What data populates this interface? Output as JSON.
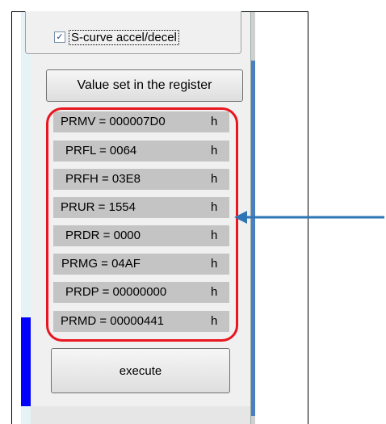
{
  "options": {
    "s_curve_checked": true,
    "s_curve_label": "S-curve accel/decel",
    "check_glyph": "✓"
  },
  "register_button_label": "Value set in the register",
  "registers": [
    {
      "text": "PRMV = 000007D0",
      "unit": "h"
    },
    {
      "text": "PRFL = 0064",
      "unit": "h"
    },
    {
      "text": "PRFH = 03E8",
      "unit": "h"
    },
    {
      "text": "PRUR = 1554",
      "unit": "h"
    },
    {
      "text": "PRDR = 0000",
      "unit": "h"
    },
    {
      "text": "PRMG = 04AF",
      "unit": "h"
    },
    {
      "text": "PRDP = 00000000",
      "unit": "h"
    },
    {
      "text": "PRMD = 00000441",
      "unit": "h"
    }
  ],
  "execute_label": "execute",
  "colors": {
    "highlight": "#e8161e",
    "arrow": "#2e75b6",
    "register_row": "#c4c4c4"
  }
}
